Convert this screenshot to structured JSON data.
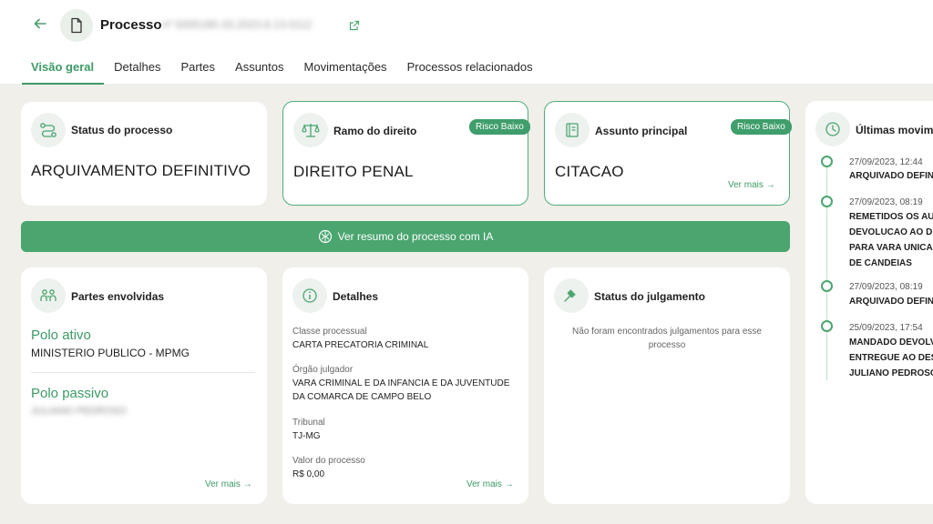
{
  "header": {
    "back_icon": "arrow-left-icon",
    "doc_icon": "file-icon",
    "title": "Processo",
    "process_number": "nº 5005180-33.2023.8.13.0112",
    "external_icon": "external-link-icon"
  },
  "tabs": [
    {
      "label": "Visão geral"
    },
    {
      "label": "Detalhes"
    },
    {
      "label": "Partes"
    },
    {
      "label": "Assuntos"
    },
    {
      "label": "Movimentações"
    },
    {
      "label": "Processos relacionados"
    }
  ],
  "status_card": {
    "title": "Status do processo",
    "value": "ARQUIVAMENTO DEFINITIVO",
    "icon": "route-icon"
  },
  "ramo_card": {
    "title": "Ramo do direito",
    "value": "DIREITO PENAL",
    "badge": "Risco Baixo",
    "icon": "scales-icon"
  },
  "assunto_card": {
    "title": "Assunto principal",
    "value": "CITACAO",
    "badge": "Risco Baixo",
    "link": "Ver mais",
    "icon": "book-icon"
  },
  "ia_button": {
    "label": "Ver resumo do processo com IA",
    "icon": "ai-brain-icon"
  },
  "partes_card": {
    "title": "Partes envolvidas",
    "polo_ativo_label": "Polo ativo",
    "polo_ativo_value": "MINISTERIO PUBLICO - MPMG",
    "polo_passivo_label": "Polo passivo",
    "polo_passivo_value": "JULIANO PEDROSO",
    "link": "Ver mais",
    "icon": "people-icon"
  },
  "detalhes_card": {
    "title": "Detalhes",
    "classe_label": "Classe processual",
    "classe_value": "CARTA PRECATORIA CRIMINAL",
    "orgao_label": "Órgão julgador",
    "orgao_value_1": "VARA CRIMINAL E DA INFANCIA E DA JUVENTUDE",
    "orgao_value_2": "DA COMARCA DE CAMPO BELO",
    "tribunal_label": "Tribunal",
    "tribunal_value": "TJ-MG",
    "valor_label": "Valor do processo",
    "valor_value": "R$ 0,00",
    "link": "Ver mais",
    "icon": "info-icon"
  },
  "julgamento_card": {
    "title": "Status do julgamento",
    "empty_1": "Não foram encontrados julgamentos para esse",
    "empty_2": "processo",
    "icon": "gavel-icon"
  },
  "movimentos_card": {
    "title": "Últimas movime",
    "icon": "clock-icon",
    "items": [
      {
        "date": "27/09/2023, 12:44",
        "lines": [
          "ARQUIVADO DEFIN"
        ]
      },
      {
        "date": "27/09/2023, 08:19",
        "lines": [
          "REMETIDOS OS AU",
          "DEVOLUCAO AO D",
          "PARA VARA UNICA",
          "DE CANDEIAS"
        ]
      },
      {
        "date": "27/09/2023, 08:19",
        "lines": [
          "ARQUIVADO DEFIN"
        ]
      },
      {
        "date": "25/09/2023, 17:54",
        "lines": [
          "MANDADO DEVOLV",
          "ENTREGUE AO DES",
          "JULIANO PEDROSO"
        ]
      }
    ]
  },
  "colors": {
    "accent": "#3d9a66",
    "bar": "#4aa56f",
    "background": "#f0efea"
  }
}
